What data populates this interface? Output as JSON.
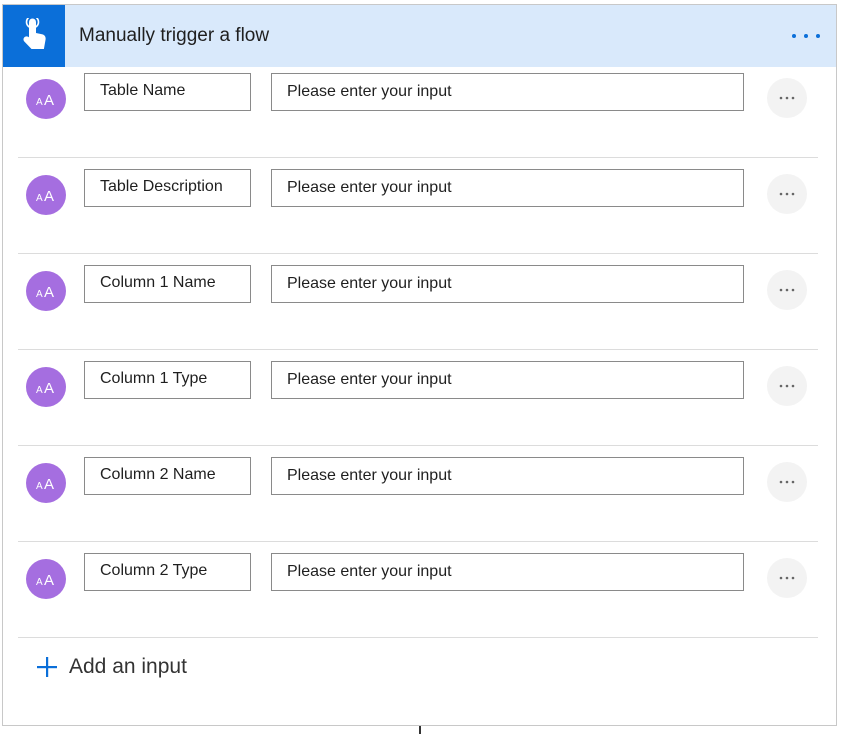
{
  "trigger": {
    "title": "Manually trigger a flow",
    "icon": "touch-hand-icon",
    "more_icon": "ellipsis-icon",
    "colors": {
      "header_bg": "#d9e9fb",
      "icon_bg": "#0b6fd9",
      "accent": "#0b6fd9"
    }
  },
  "inputs": [
    {
      "name": "Table Name",
      "placeholder": "Please enter your input",
      "icon": "text-input-icon"
    },
    {
      "name": "Table Description",
      "placeholder": "Please enter your input",
      "icon": "text-input-icon"
    },
    {
      "name": "Column 1 Name",
      "placeholder": "Please enter your input",
      "icon": "text-input-icon"
    },
    {
      "name": "Column 1 Type",
      "placeholder": "Please enter your input",
      "icon": "text-input-icon"
    },
    {
      "name": "Column 2 Name",
      "placeholder": "Please enter your input",
      "icon": "text-input-icon"
    },
    {
      "name": "Column 2 Type",
      "placeholder": "Please enter your input",
      "icon": "text-input-icon"
    }
  ],
  "add_input": {
    "label": "Add an input",
    "icon": "plus-icon"
  },
  "input_avatar_color": "#a56ee0"
}
